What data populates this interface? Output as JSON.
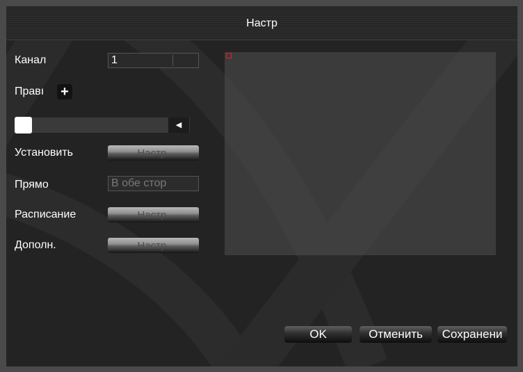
{
  "dialog": {
    "title": "Настр"
  },
  "form": {
    "channel": {
      "label": "Канал",
      "value": "1"
    },
    "rule": {
      "label": "Правı",
      "add_icon": "plus-icon"
    },
    "slider": {
      "arrow_icon": "triangle-left-icon"
    },
    "set": {
      "label": "Установить",
      "button": "Настр."
    },
    "direction": {
      "label": "Прямо",
      "value": "В обе стор"
    },
    "schedule": {
      "label": "Расписание",
      "button": "Настр."
    },
    "advanced": {
      "label": "Дополн.",
      "button": "Настр."
    }
  },
  "actions": {
    "ok": "OK",
    "cancel": "Отменить",
    "save": "Сохранени"
  },
  "colors": {
    "background": "#232323",
    "roi_marker": "#e02020"
  }
}
